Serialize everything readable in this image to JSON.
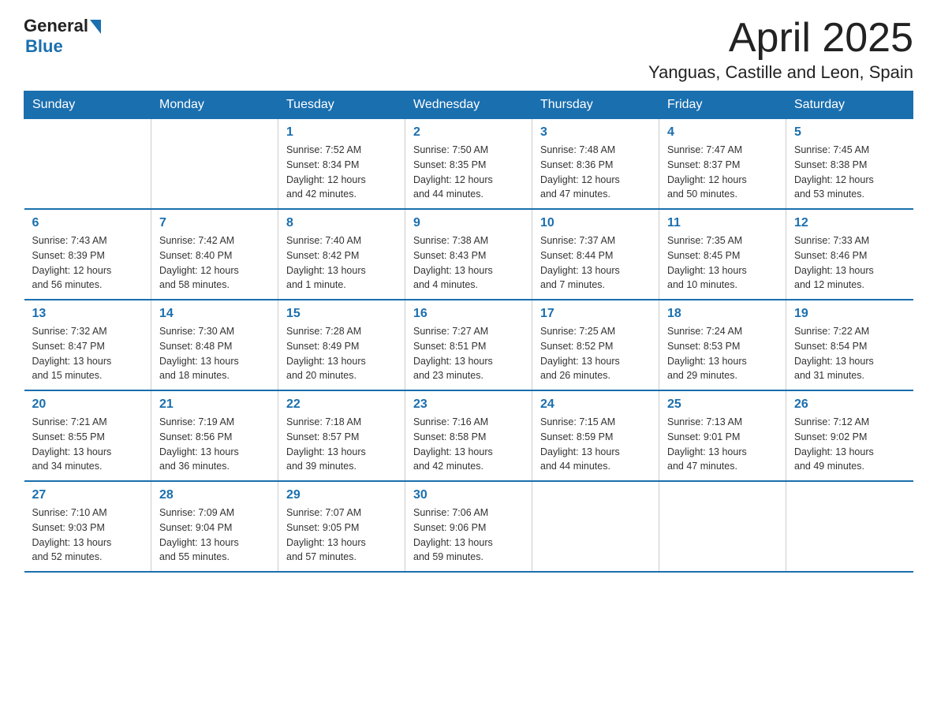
{
  "header": {
    "logo": {
      "general": "General",
      "blue": "Blue",
      "triangle_color": "#1a6faf"
    },
    "title": "April 2025",
    "subtitle": "Yanguas, Castille and Leon, Spain"
  },
  "calendar": {
    "days_of_week": [
      "Sunday",
      "Monday",
      "Tuesday",
      "Wednesday",
      "Thursday",
      "Friday",
      "Saturday"
    ],
    "weeks": [
      [
        {
          "day": "",
          "info": ""
        },
        {
          "day": "",
          "info": ""
        },
        {
          "day": "1",
          "info": "Sunrise: 7:52 AM\nSunset: 8:34 PM\nDaylight: 12 hours\nand 42 minutes."
        },
        {
          "day": "2",
          "info": "Sunrise: 7:50 AM\nSunset: 8:35 PM\nDaylight: 12 hours\nand 44 minutes."
        },
        {
          "day": "3",
          "info": "Sunrise: 7:48 AM\nSunset: 8:36 PM\nDaylight: 12 hours\nand 47 minutes."
        },
        {
          "day": "4",
          "info": "Sunrise: 7:47 AM\nSunset: 8:37 PM\nDaylight: 12 hours\nand 50 minutes."
        },
        {
          "day": "5",
          "info": "Sunrise: 7:45 AM\nSunset: 8:38 PM\nDaylight: 12 hours\nand 53 minutes."
        }
      ],
      [
        {
          "day": "6",
          "info": "Sunrise: 7:43 AM\nSunset: 8:39 PM\nDaylight: 12 hours\nand 56 minutes."
        },
        {
          "day": "7",
          "info": "Sunrise: 7:42 AM\nSunset: 8:40 PM\nDaylight: 12 hours\nand 58 minutes."
        },
        {
          "day": "8",
          "info": "Sunrise: 7:40 AM\nSunset: 8:42 PM\nDaylight: 13 hours\nand 1 minute."
        },
        {
          "day": "9",
          "info": "Sunrise: 7:38 AM\nSunset: 8:43 PM\nDaylight: 13 hours\nand 4 minutes."
        },
        {
          "day": "10",
          "info": "Sunrise: 7:37 AM\nSunset: 8:44 PM\nDaylight: 13 hours\nand 7 minutes."
        },
        {
          "day": "11",
          "info": "Sunrise: 7:35 AM\nSunset: 8:45 PM\nDaylight: 13 hours\nand 10 minutes."
        },
        {
          "day": "12",
          "info": "Sunrise: 7:33 AM\nSunset: 8:46 PM\nDaylight: 13 hours\nand 12 minutes."
        }
      ],
      [
        {
          "day": "13",
          "info": "Sunrise: 7:32 AM\nSunset: 8:47 PM\nDaylight: 13 hours\nand 15 minutes."
        },
        {
          "day": "14",
          "info": "Sunrise: 7:30 AM\nSunset: 8:48 PM\nDaylight: 13 hours\nand 18 minutes."
        },
        {
          "day": "15",
          "info": "Sunrise: 7:28 AM\nSunset: 8:49 PM\nDaylight: 13 hours\nand 20 minutes."
        },
        {
          "day": "16",
          "info": "Sunrise: 7:27 AM\nSunset: 8:51 PM\nDaylight: 13 hours\nand 23 minutes."
        },
        {
          "day": "17",
          "info": "Sunrise: 7:25 AM\nSunset: 8:52 PM\nDaylight: 13 hours\nand 26 minutes."
        },
        {
          "day": "18",
          "info": "Sunrise: 7:24 AM\nSunset: 8:53 PM\nDaylight: 13 hours\nand 29 minutes."
        },
        {
          "day": "19",
          "info": "Sunrise: 7:22 AM\nSunset: 8:54 PM\nDaylight: 13 hours\nand 31 minutes."
        }
      ],
      [
        {
          "day": "20",
          "info": "Sunrise: 7:21 AM\nSunset: 8:55 PM\nDaylight: 13 hours\nand 34 minutes."
        },
        {
          "day": "21",
          "info": "Sunrise: 7:19 AM\nSunset: 8:56 PM\nDaylight: 13 hours\nand 36 minutes."
        },
        {
          "day": "22",
          "info": "Sunrise: 7:18 AM\nSunset: 8:57 PM\nDaylight: 13 hours\nand 39 minutes."
        },
        {
          "day": "23",
          "info": "Sunrise: 7:16 AM\nSunset: 8:58 PM\nDaylight: 13 hours\nand 42 minutes."
        },
        {
          "day": "24",
          "info": "Sunrise: 7:15 AM\nSunset: 8:59 PM\nDaylight: 13 hours\nand 44 minutes."
        },
        {
          "day": "25",
          "info": "Sunrise: 7:13 AM\nSunset: 9:01 PM\nDaylight: 13 hours\nand 47 minutes."
        },
        {
          "day": "26",
          "info": "Sunrise: 7:12 AM\nSunset: 9:02 PM\nDaylight: 13 hours\nand 49 minutes."
        }
      ],
      [
        {
          "day": "27",
          "info": "Sunrise: 7:10 AM\nSunset: 9:03 PM\nDaylight: 13 hours\nand 52 minutes."
        },
        {
          "day": "28",
          "info": "Sunrise: 7:09 AM\nSunset: 9:04 PM\nDaylight: 13 hours\nand 55 minutes."
        },
        {
          "day": "29",
          "info": "Sunrise: 7:07 AM\nSunset: 9:05 PM\nDaylight: 13 hours\nand 57 minutes."
        },
        {
          "day": "30",
          "info": "Sunrise: 7:06 AM\nSunset: 9:06 PM\nDaylight: 13 hours\nand 59 minutes."
        },
        {
          "day": "",
          "info": ""
        },
        {
          "day": "",
          "info": ""
        },
        {
          "day": "",
          "info": ""
        }
      ]
    ]
  }
}
